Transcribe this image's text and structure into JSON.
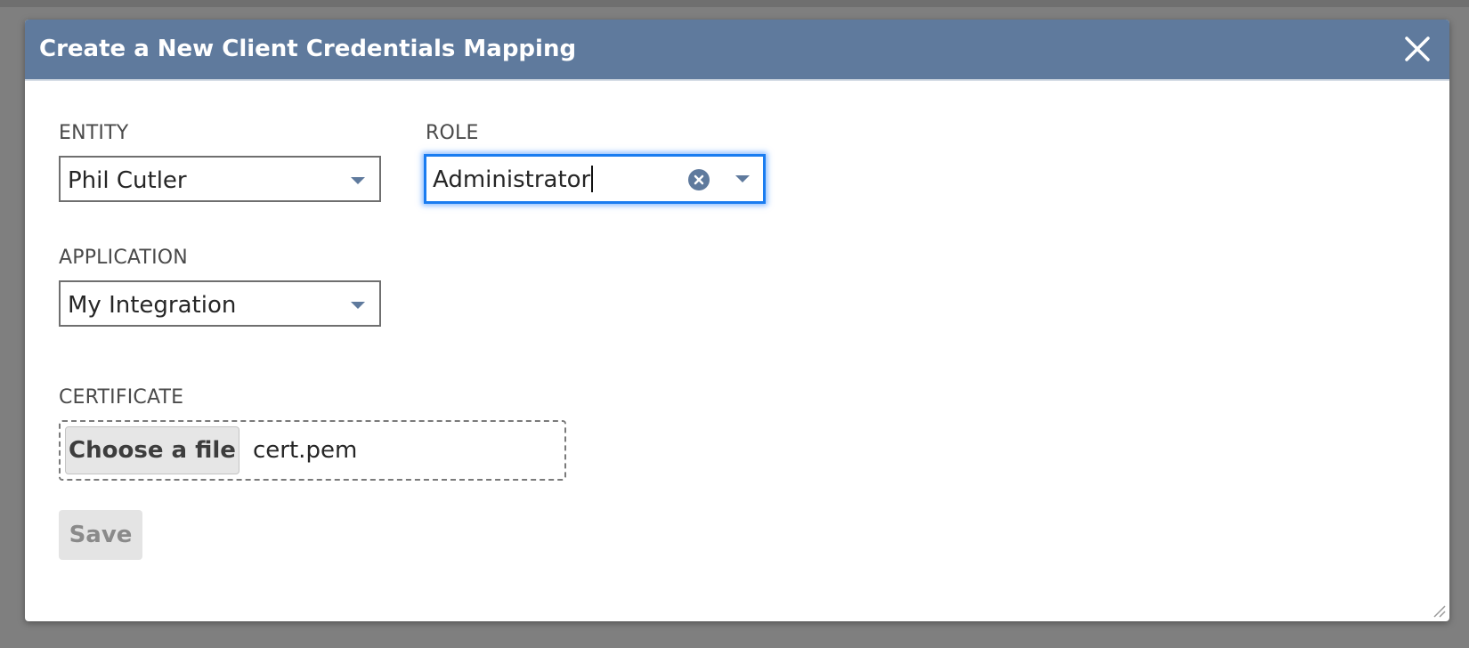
{
  "dialog": {
    "title": "Create a New Client Credentials Mapping",
    "close_icon": "close-icon",
    "header_color": "#5f7a9d"
  },
  "form": {
    "entity": {
      "label": "ENTITY",
      "value": "Phil Cutler",
      "icon": "chevron-down-icon"
    },
    "role": {
      "label": "ROLE",
      "value": "Administrator",
      "focused": true,
      "focus_color": "#1a7cf0",
      "clear_icon": "clear-icon",
      "icon": "chevron-down-icon"
    },
    "application": {
      "label": "APPLICATION",
      "value": "My Integration",
      "icon": "chevron-down-icon"
    },
    "certificate": {
      "label": "CERTIFICATE",
      "button_label": "Choose a file",
      "file_name": "cert.pem"
    },
    "save_label": "Save",
    "save_disabled": true
  }
}
